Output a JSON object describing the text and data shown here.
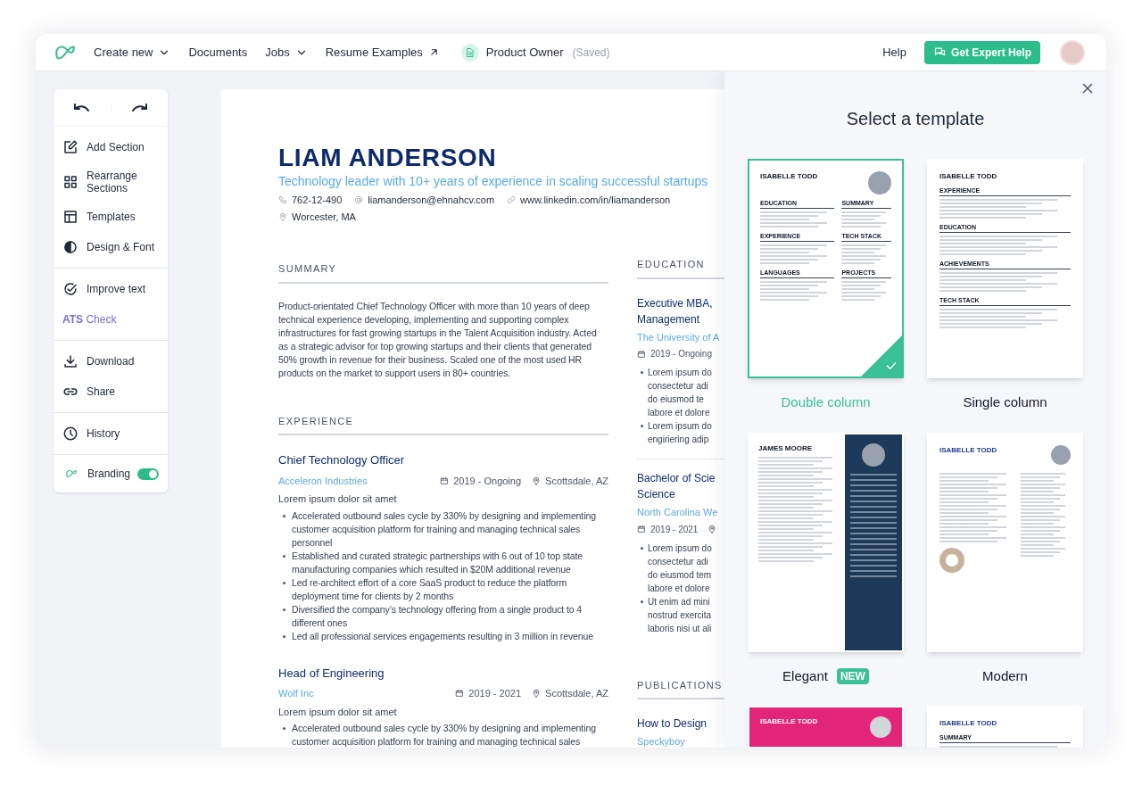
{
  "topbar": {
    "nav": [
      {
        "label": "Create new",
        "kind": "dropdown"
      },
      {
        "label": "Documents",
        "kind": "link"
      },
      {
        "label": "Jobs",
        "kind": "dropdown"
      },
      {
        "label": "Resume Examples",
        "kind": "external"
      }
    ],
    "document": {
      "name": "Product Owner",
      "status": "(Saved)"
    },
    "help": "Help",
    "cta": "Get Expert Help"
  },
  "toolbar": {
    "groups": [
      [
        {
          "label": "Add Section",
          "kind": "add"
        },
        {
          "label": "Rearrange Sections",
          "kind": "rearrange"
        },
        {
          "label": "Templates",
          "kind": "templates"
        },
        {
          "label": "Design & Font",
          "kind": "design"
        }
      ],
      [
        {
          "label": "Improve text",
          "kind": "improve"
        },
        {
          "label": "**ATS** Check",
          "kind": "ats"
        }
      ],
      [
        {
          "label": "Download",
          "kind": "download"
        },
        {
          "label": "Share",
          "kind": "share"
        }
      ],
      [
        {
          "label": "History",
          "kind": "history"
        }
      ]
    ],
    "branding": {
      "label": "Branding",
      "on": true
    }
  },
  "resume": {
    "name": "LIAM ANDERSON",
    "tagline": "Technology leader with 10+ years of experience in scaling successful startups",
    "contacts": [
      {
        "kind": "phone",
        "text": "762-12-490"
      },
      {
        "kind": "email",
        "text": "liamanderson@ehnahcv.com"
      },
      {
        "kind": "link",
        "text": "www.linkedin.com/in/liamanderson"
      },
      {
        "kind": "location",
        "text": "Worcester, MA"
      }
    ],
    "summary": {
      "heading": "SUMMARY",
      "text": "Product-orientated Chief Technology Officer with more than 10 years of deep technical experience developing, implementing and supporting complex infrastructures for fast growing startups in the Talent Acquisition industry. Acted as a strategic advisor for top growing startups and their clients that generated 50% growth in revenue for their business. Scaled one of the most used HR products on the market to support users in 80+ countries."
    },
    "experience": {
      "heading": "EXPERIENCE",
      "jobs": [
        {
          "title": "Chief Technology Officer",
          "company": "Acceleron Industries",
          "dates": "2019 - Ongoing",
          "location": "Scottsdale, AZ",
          "description": "Lorem ipsum dolor sit amet",
          "bullets": [
            "Accelerated outbound sales cycle by 330% by designing and implementing customer acquisition platform for training and managing technical sales personnel",
            "Established and curated strategic partnerships with 6 out of 10 top state manufacturing companies which resulted in $20M additional revenue",
            "Led re-architect effort of a core SaaS product to reduce the platform deployment time for clients by 2 months",
            "Diversified the company’s technology offering from a single product to 4 different ones",
            "Led all professional services engagements resulting in 3 million in revenue"
          ]
        },
        {
          "title": "Head of Engineering",
          "company": "Wolf Inc",
          "dates": "2019 - 2021",
          "location": "Scottsdale, AZ",
          "description": "Lorem ipsum dolor sit amet",
          "bullets": [
            "Accelerated outbound sales cycle by 330% by designing and implementing customer acquisition platform for training and managing technical sales"
          ]
        }
      ]
    },
    "education": {
      "heading": "EDUCATION",
      "entries": [
        {
          "title_lines": [
            "Executive MBA,",
            "Management"
          ],
          "school": "The University of A",
          "dates": "2019 - Ongoing",
          "location_icon": false,
          "bullets": [
            [
              "Lorem ipsum do",
              "consectetur adi",
              "do eiusmod te",
              "labore et dolore"
            ],
            [
              "Lorem ipsum do",
              "engiriering adip"
            ]
          ]
        },
        {
          "title_lines": [
            "Bachelor of Scie",
            "Science"
          ],
          "school": "North Carolina We",
          "dates": "2019 - 2021",
          "location_icon": true,
          "bullets": [
            [
              "Lorem ipsum do",
              "consectetur adi",
              "do eiusmod tem",
              "labore et dolore"
            ],
            [
              "Ut enim ad mini",
              "nostrud exercita",
              "laboris nisi ut ali"
            ]
          ]
        }
      ]
    },
    "publications": {
      "heading": "PUBLICATIONS",
      "entries": [
        {
          "title": "How to Design",
          "source": "Speckyboy"
        }
      ]
    }
  },
  "template_panel": {
    "title": "Select a template",
    "templates": [
      {
        "kind": "double",
        "label": "Double column",
        "selected": true,
        "name": "ISABELLE TODD",
        "headings": [
          "EDUCATION",
          "SUMMARY",
          "EXPERIENCE",
          "TECH STACK",
          "LANGUAGES",
          "PROJECTS"
        ]
      },
      {
        "kind": "single",
        "label": "Single column",
        "selected": false,
        "name": "ISABELLE TODD",
        "headings": [
          "EXPERIENCE",
          "EDUCATION",
          "ACHIEVEMENTS",
          "TECH STACK"
        ]
      },
      {
        "kind": "elegant",
        "label": "Elegant",
        "badge": "NEW",
        "selected": false,
        "name": "JAMES MOORE"
      },
      {
        "kind": "modern",
        "label": "Modern",
        "selected": false,
        "name": "ISABELLE TODD"
      },
      {
        "kind": "banner",
        "selected": false,
        "name": "ISABELLE TODD"
      },
      {
        "kind": "classic",
        "selected": false,
        "name": "ISABELLE TODD",
        "headings": [
          "SUMMARY"
        ]
      }
    ]
  }
}
